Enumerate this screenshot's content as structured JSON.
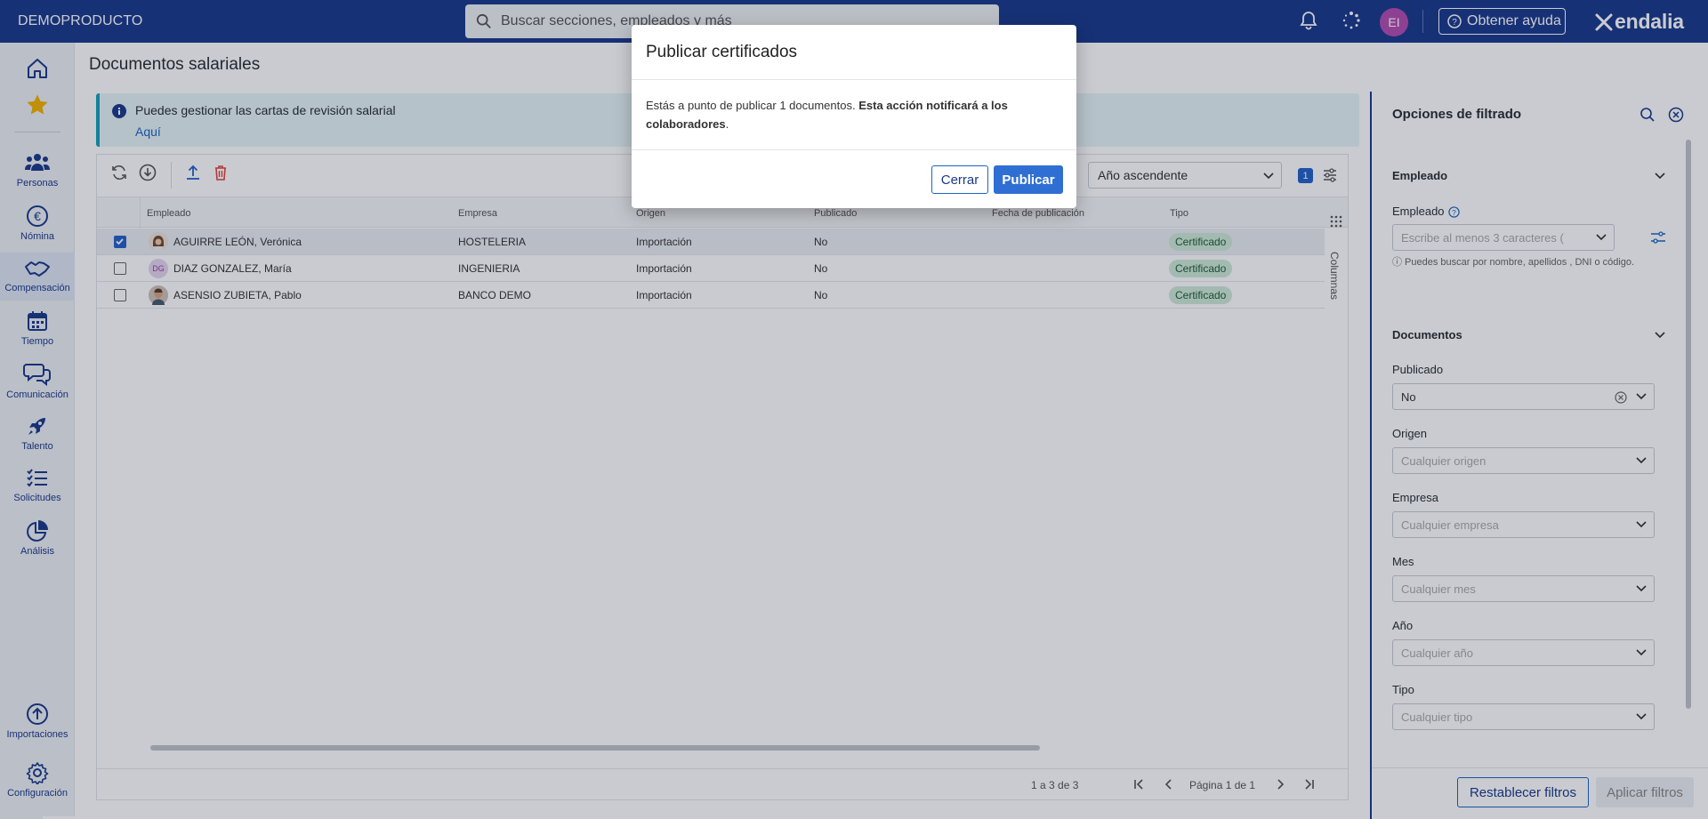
{
  "topbar": {
    "brand": "DEMOPRODUCTO",
    "search_placeholder": "Buscar secciones, empleados y más",
    "avatar_initials": "EI",
    "help_label": "Obtener ayuda",
    "logo_text": "endalia"
  },
  "sidebar": {
    "items": [
      {
        "label": "Personas",
        "icon": "people-icon"
      },
      {
        "label": "Nómina",
        "icon": "euro-icon"
      },
      {
        "label": "Compensación",
        "icon": "handshake-icon"
      },
      {
        "label": "Tiempo",
        "icon": "calendar-icon"
      },
      {
        "label": "Comunicación",
        "icon": "chat-icon"
      },
      {
        "label": "Talento",
        "icon": "rocket-icon"
      },
      {
        "label": "Solicitudes",
        "icon": "checklist-icon"
      },
      {
        "label": "Análisis",
        "icon": "pie-chart-icon"
      }
    ],
    "bottom": [
      {
        "label": "Importaciones",
        "icon": "upload-circle-icon"
      },
      {
        "label": "Configuración",
        "icon": "gear-icon"
      }
    ]
  },
  "page": {
    "title": "Documentos salariales",
    "info_message": "Puedes gestionar las cartas de revisión salarial",
    "info_link": "Aquí"
  },
  "grid": {
    "sort_value": "Año ascendente",
    "filter_count": "1",
    "columns_label": "Columnas",
    "headers": [
      "Empleado",
      "Empresa",
      "Origen",
      "Publicado",
      "Fecha de publicación",
      "Tipo"
    ],
    "rows": [
      {
        "empleado": "AGUIRRE LEÓN, Verónica",
        "empresa": "HOSTELERIA",
        "origen": "Importación",
        "publicado": "No",
        "fecha": "",
        "tipo": "Certificado",
        "checked": true,
        "initials": ""
      },
      {
        "empleado": "DIAZ GONZALEZ, María",
        "empresa": "INGENIERIA",
        "origen": "Importación",
        "publicado": "No",
        "fecha": "",
        "tipo": "Certificado",
        "checked": false,
        "initials": "DG"
      },
      {
        "empleado": "ASENSIO ZUBIETA, Pablo",
        "empresa": "BANCO DEMO",
        "origen": "Importación",
        "publicado": "No",
        "fecha": "",
        "tipo": "Certificado",
        "checked": false,
        "initials": ""
      }
    ],
    "range_text": "1 a 3 de 3",
    "page_text": "Página 1 de 1"
  },
  "filters": {
    "title": "Opciones de filtrado",
    "employee_section": "Empleado",
    "employee_label": "Empleado",
    "employee_placeholder": "Escribe al menos 3 caracteres (",
    "employee_hint": "ⓘ Puedes buscar por nombre, apellidos , DNI o código.",
    "documents_section": "Documentos",
    "publicado_label": "Publicado",
    "publicado_value": "No",
    "origen_label": "Origen",
    "origen_placeholder": "Cualquier origen",
    "empresa_label": "Empresa",
    "empresa_placeholder": "Cualquier empresa",
    "mes_label": "Mes",
    "mes_placeholder": "Cualquier mes",
    "anio_label": "Año",
    "anio_placeholder": "Cualquier año",
    "tipo_label": "Tipo",
    "tipo_placeholder": "Cualquier tipo",
    "reset_label": "Restablecer filtros",
    "apply_label": "Aplicar filtros"
  },
  "modal": {
    "title": "Publicar certificados",
    "body_text": "Estás a punto de publicar 1 documentos. ",
    "body_bold": "Esta acción notificará a los colaboradores",
    "body_end": ".",
    "close_label": "Cerrar",
    "publish_label": "Publicar"
  },
  "colors": {
    "primary": "#1b3a8c",
    "accent": "#2f6fd3",
    "tag_bg": "#cfe9d8",
    "info_border": "#17a2b8"
  }
}
